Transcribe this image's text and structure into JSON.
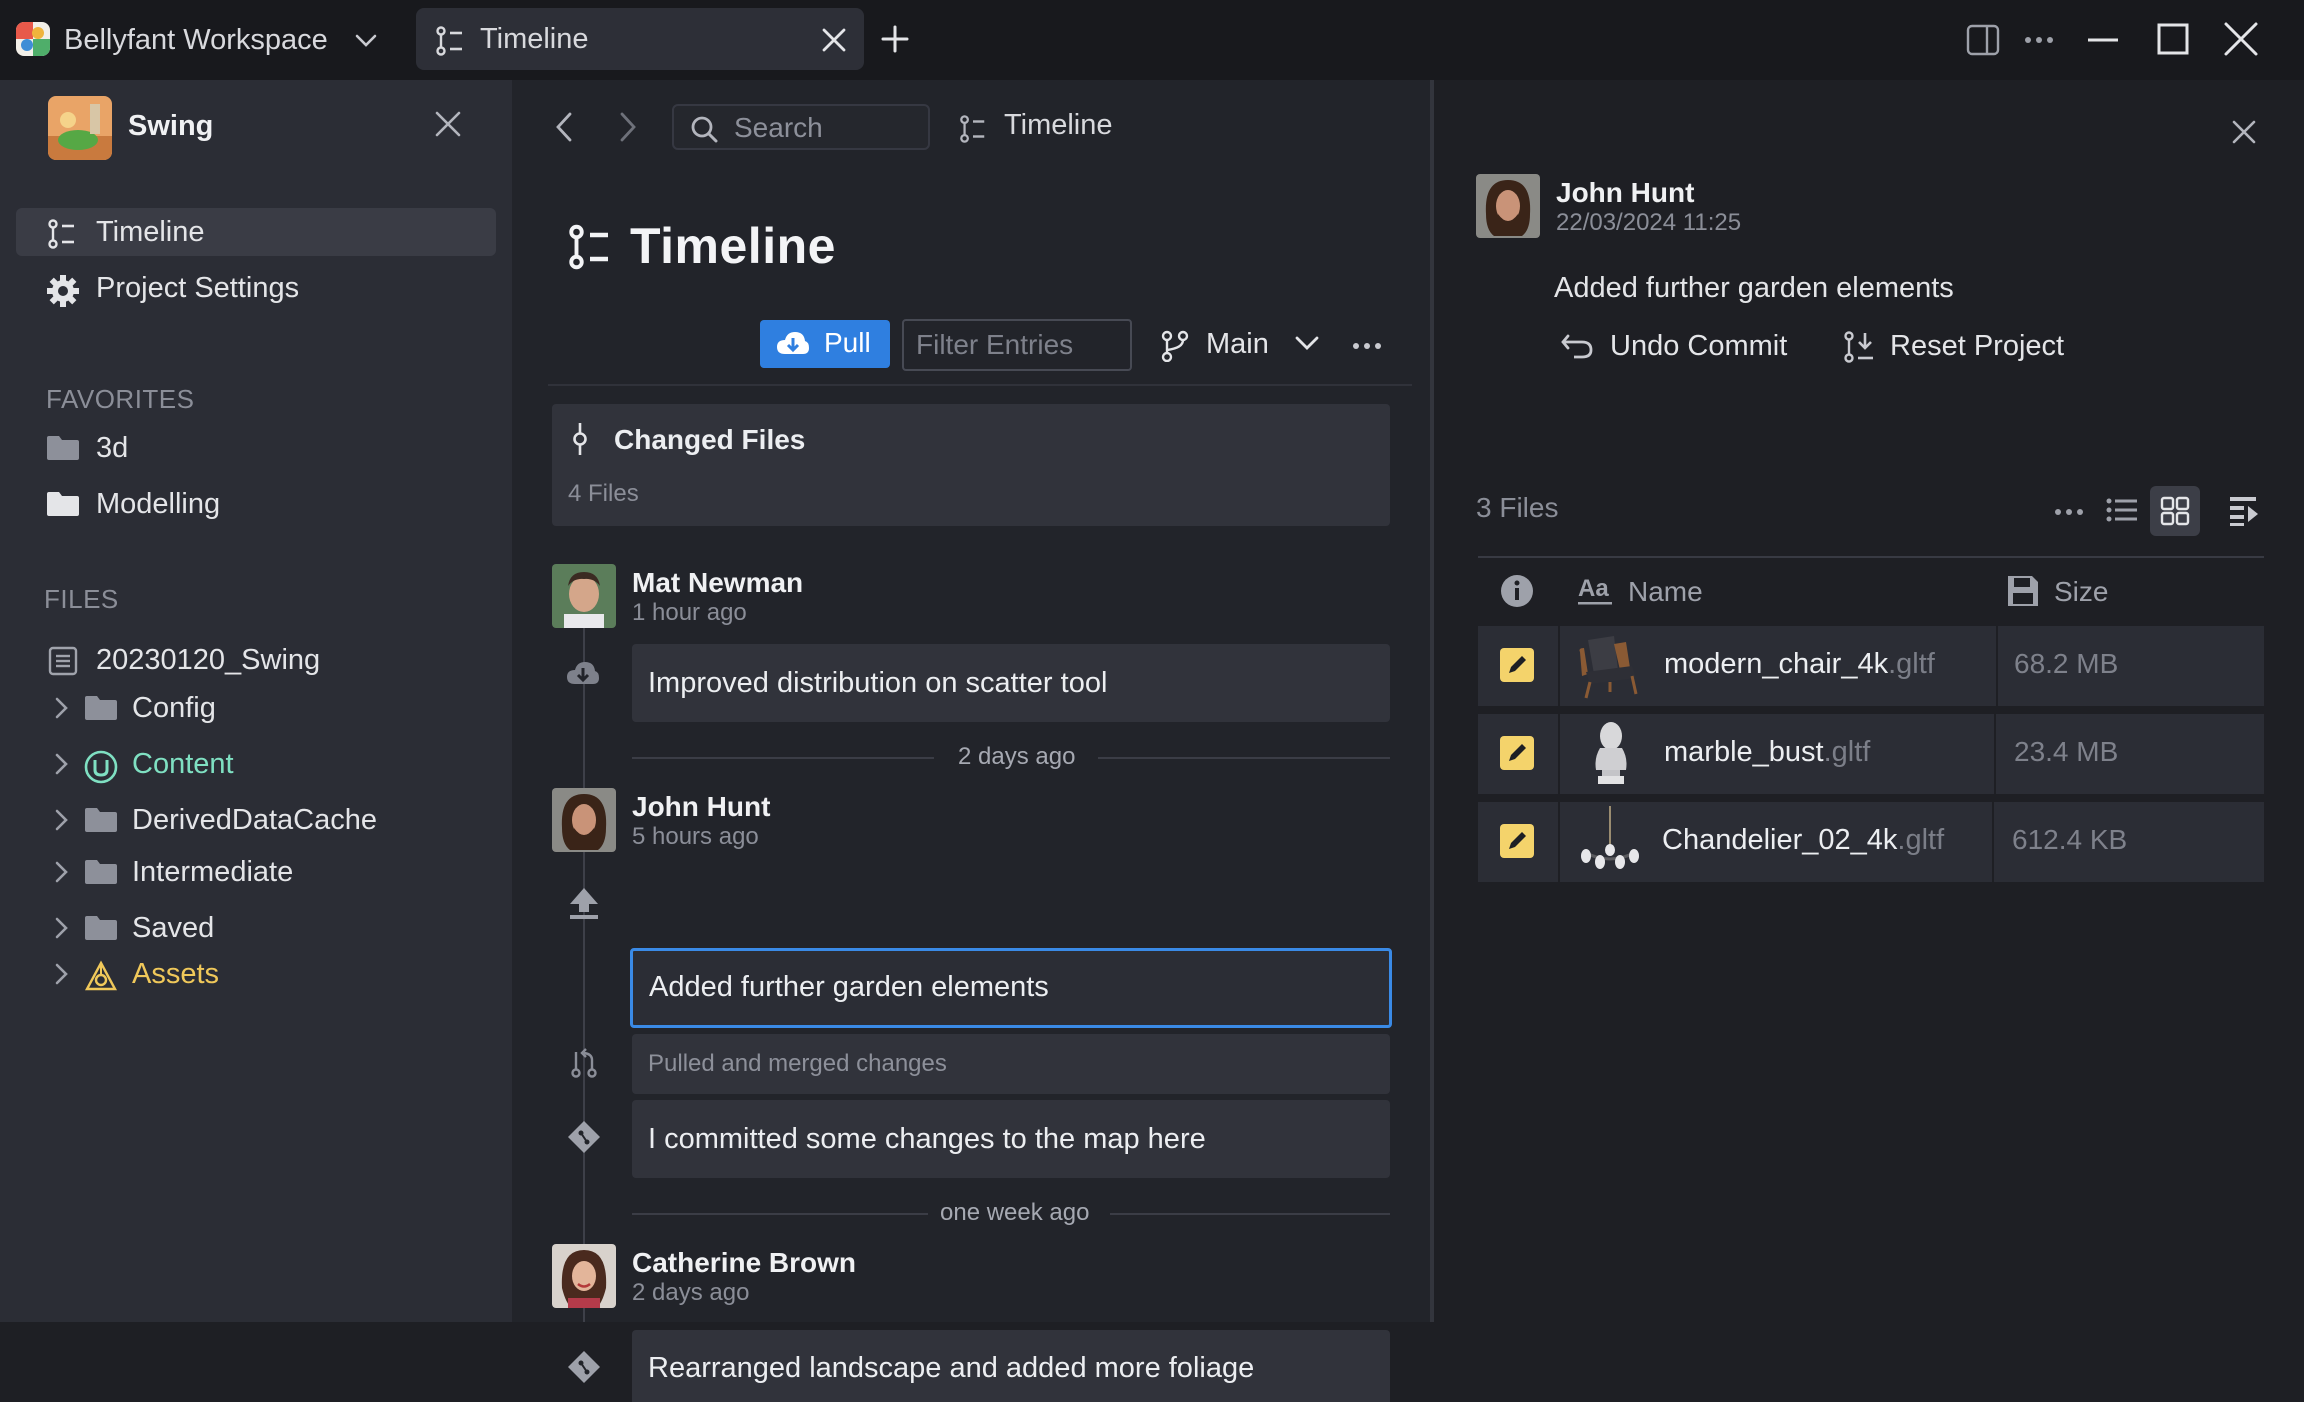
{
  "titlebar": {
    "workspace": "Bellyfant Workspace",
    "tab_label": "Timeline"
  },
  "sidebar": {
    "project_name": "Swing",
    "nav": [
      {
        "label": "Timeline",
        "icon": "timeline-icon",
        "active": true
      },
      {
        "label": "Project Settings",
        "icon": "gear-icon",
        "active": false
      }
    ],
    "favorites_label": "FAVORITES",
    "favorites": [
      {
        "label": "3d",
        "icon": "folder-icon"
      },
      {
        "label": "Modelling",
        "icon": "folder-icon"
      }
    ],
    "files_label": "FILES",
    "root_file": "20230120_Swing",
    "tree": [
      {
        "label": "Config",
        "icon": "folder-icon",
        "color": "#e4e5e8"
      },
      {
        "label": "Content",
        "icon": "unreal-icon",
        "color": "#7fe0c2"
      },
      {
        "label": "DerivedDataCache",
        "icon": "folder-icon",
        "color": "#e4e5e8"
      },
      {
        "label": "Intermediate",
        "icon": "folder-icon",
        "color": "#e4e5e8"
      },
      {
        "label": "Saved",
        "icon": "folder-icon",
        "color": "#e4e5e8"
      },
      {
        "label": "Assets",
        "icon": "assets-icon",
        "color": "#f0c85a"
      }
    ]
  },
  "main": {
    "search_placeholder": "Search",
    "breadcrumb": "Timeline",
    "title": "Timeline",
    "pull_label": "Pull",
    "filter_placeholder": "Filter Entries",
    "branch": "Main",
    "changed_files": {
      "title": "Changed Files",
      "count": "4 Files"
    },
    "timeline": {
      "author1": {
        "name": "Mat Newman",
        "time": "1 hour ago",
        "message": "Improved distribution on scatter tool"
      },
      "sep1": "2 days ago",
      "author2": {
        "name": "John Hunt",
        "time": "5 hours ago"
      },
      "entry_selected": "Added further garden elements",
      "entry_merge": "Pulled and merged changes",
      "entry_commit": "I committed some changes to the map here",
      "sep2": "one week ago",
      "author3": {
        "name": "Catherine Brown",
        "time": "2 days ago",
        "message": "Rearranged landscape and added more foliage"
      }
    }
  },
  "detail": {
    "author": "John Hunt",
    "date": "22/03/2024 11:25",
    "message": "Added further garden elements",
    "undo_label": "Undo Commit",
    "reset_label": "Reset Project",
    "files_count": "3 Files",
    "col_name": "Name",
    "col_size": "Size",
    "files": [
      {
        "name": "modern_chair_4k",
        "ext": ".gltf",
        "size": "68.2 MB"
      },
      {
        "name": "marble_bust",
        "ext": ".gltf",
        "size": "23.4 MB"
      },
      {
        "name": "Chandelier_02_4k",
        "ext": ".gltf",
        "size": "612.4 KB"
      }
    ]
  },
  "colors": {
    "accent": "#2f7fe0",
    "selection": "#3a8ae6",
    "modified": "#f4d36b",
    "content_folder": "#7fe0c2",
    "assets_folder": "#f0c85a"
  }
}
